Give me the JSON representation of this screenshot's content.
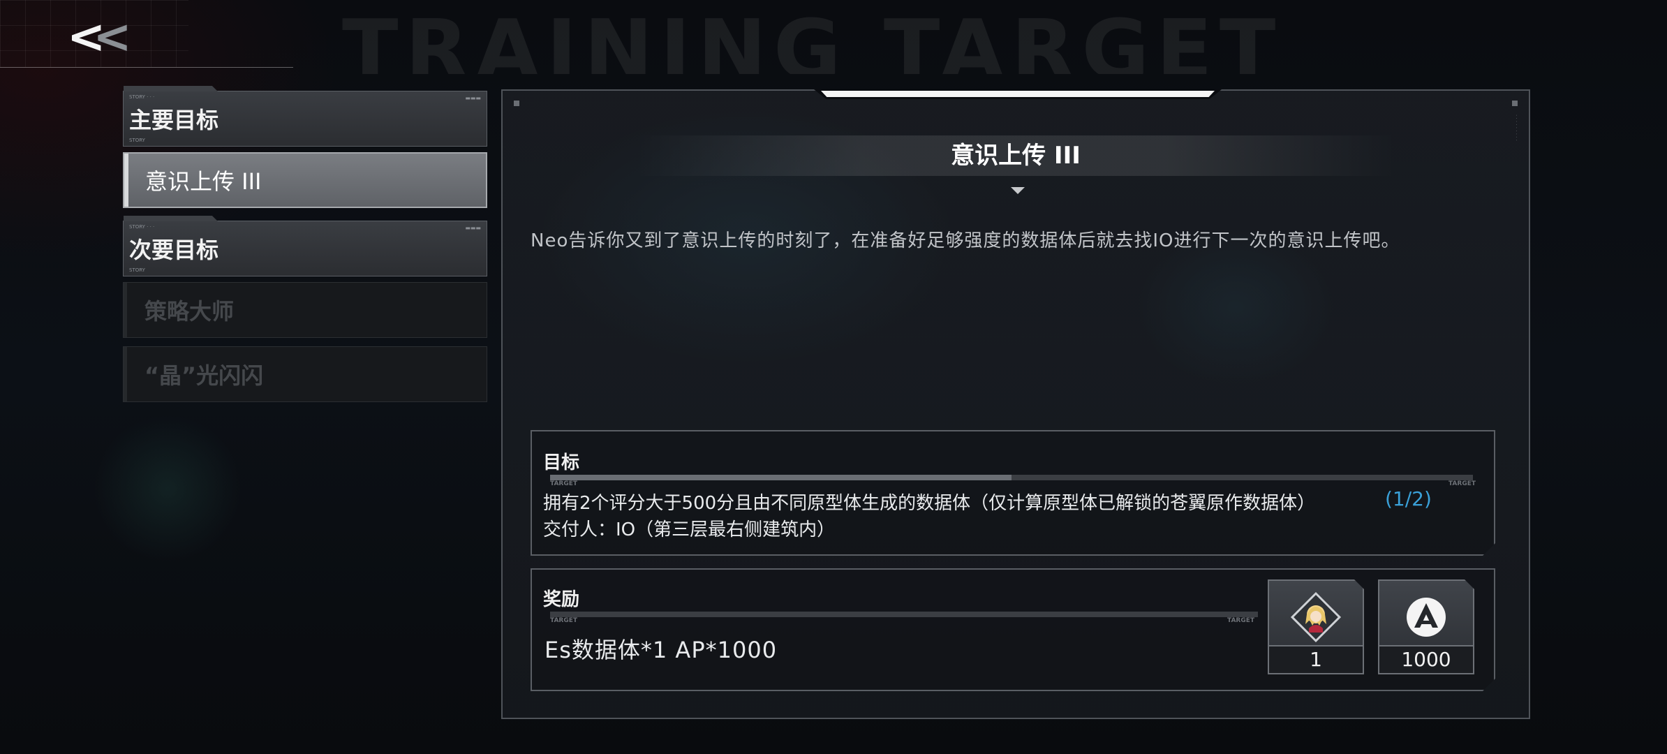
{
  "header": {
    "back_label": "<<",
    "watermark": "TRAINING TARGET"
  },
  "sidebar": {
    "items": [
      {
        "label": "主要目标",
        "type": "category"
      },
      {
        "label": "意识上传 III",
        "type": "selected"
      },
      {
        "label": "次要目标",
        "type": "category"
      },
      {
        "label": "策略大师",
        "type": "disabled"
      },
      {
        "label": "“晶”光闪闪",
        "type": "disabled"
      }
    ]
  },
  "panel": {
    "title": "意识上传 III",
    "description": "Neo告诉你又到了意识上传的时刻了，在准备好足够强度的数据体后就去找IO进行下一次的意识上传吧。",
    "target": {
      "label": "目标",
      "micro_left": "TARGET",
      "micro_right": "TARGET",
      "text": "拥有2个评分大于500分且由不同原型体生成的数据体（仅计算原型体已解锁的苍翼原作数据体）",
      "count": "(1/2)",
      "progress": 0.5,
      "giver": "交付人：IO（第三层最右侧建筑内）"
    },
    "reward": {
      "label": "奖励",
      "micro_left": "TARGET",
      "micro_right": "TARGET",
      "text": "Es数据体*1  AP*1000",
      "items": [
        {
          "icon": "character-portrait-icon",
          "count": "1"
        },
        {
          "icon": "ap-currency-icon",
          "count": "1000"
        }
      ]
    }
  },
  "colors": {
    "accent_blue": "#3aa0d8",
    "panel_border": "#4f5359"
  }
}
